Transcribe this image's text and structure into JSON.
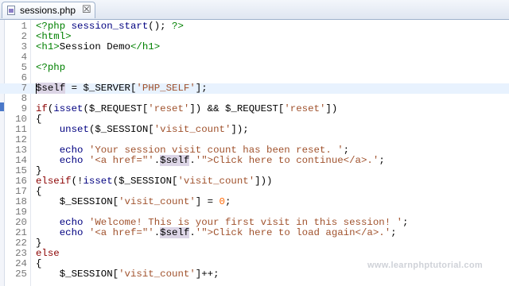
{
  "tab": {
    "filename": "sessions.php",
    "close_glyph": "☒"
  },
  "watermark": "www.learnphptutorial.com",
  "colors": {
    "tag": "#008000",
    "keyword": "#8b0000",
    "function": "#000080",
    "string": "#a0522d",
    "number": "#ff6600",
    "current_line": "#e8f2fe"
  },
  "current_line": 7,
  "lines": [
    {
      "n": "1",
      "tokens": [
        [
          "tag",
          "<?php "
        ],
        [
          "fn",
          "session_start"
        ],
        [
          "var",
          "(); "
        ],
        [
          "tag",
          "?>"
        ]
      ]
    },
    {
      "n": "2",
      "tokens": [
        [
          "tag",
          "<html>"
        ]
      ]
    },
    {
      "n": "3",
      "tokens": [
        [
          "tag",
          "<h1>"
        ],
        [
          "var",
          "Session Demo"
        ],
        [
          "tag",
          "</h1>"
        ]
      ]
    },
    {
      "n": "4",
      "tokens": []
    },
    {
      "n": "5",
      "tokens": [
        [
          "tag",
          "<?php"
        ]
      ]
    },
    {
      "n": "6",
      "tokens": []
    },
    {
      "n": "7",
      "tokens": [
        [
          "hl",
          "$self"
        ],
        [
          "var",
          " = $_SERVER["
        ],
        [
          "str",
          "'PHP_SELF'"
        ],
        [
          "var",
          "];"
        ]
      ]
    },
    {
      "n": "8",
      "tokens": []
    },
    {
      "n": "9",
      "tokens": [
        [
          "kw",
          "if"
        ],
        [
          "var",
          "("
        ],
        [
          "fn",
          "isset"
        ],
        [
          "var",
          "($_REQUEST["
        ],
        [
          "str",
          "'reset'"
        ],
        [
          "var",
          "]) && $_REQUEST["
        ],
        [
          "str",
          "'reset'"
        ],
        [
          "var",
          "])"
        ]
      ]
    },
    {
      "n": "10",
      "tokens": [
        [
          "var",
          "{"
        ]
      ]
    },
    {
      "n": "11",
      "tokens": [
        [
          "var",
          "    "
        ],
        [
          "fn",
          "unset"
        ],
        [
          "var",
          "($_SESSION["
        ],
        [
          "str",
          "'visit_count'"
        ],
        [
          "var",
          "]);"
        ]
      ]
    },
    {
      "n": "12",
      "tokens": []
    },
    {
      "n": "13",
      "tokens": [
        [
          "var",
          "    "
        ],
        [
          "fn",
          "echo"
        ],
        [
          "var",
          " "
        ],
        [
          "str",
          "'Your session visit count has been reset. '"
        ],
        [
          "var",
          ";"
        ]
      ]
    },
    {
      "n": "14",
      "tokens": [
        [
          "var",
          "    "
        ],
        [
          "fn",
          "echo"
        ],
        [
          "var",
          " "
        ],
        [
          "str",
          "'<a href=\"'"
        ],
        [
          "var",
          "."
        ],
        [
          "hl",
          "$self"
        ],
        [
          "var",
          "."
        ],
        [
          "str",
          "'\">Click here to continue</a>.'"
        ],
        [
          "var",
          ";"
        ]
      ]
    },
    {
      "n": "15",
      "tokens": [
        [
          "var",
          "}"
        ]
      ]
    },
    {
      "n": "16",
      "tokens": [
        [
          "kw",
          "elseif"
        ],
        [
          "var",
          "(!"
        ],
        [
          "fn",
          "isset"
        ],
        [
          "var",
          "($_SESSION["
        ],
        [
          "str",
          "'visit_count'"
        ],
        [
          "var",
          "]))"
        ]
      ]
    },
    {
      "n": "17",
      "tokens": [
        [
          "var",
          "{"
        ]
      ]
    },
    {
      "n": "18",
      "tokens": [
        [
          "var",
          "    $_SESSION["
        ],
        [
          "str",
          "'visit_count'"
        ],
        [
          "var",
          "] = "
        ],
        [
          "num",
          "0"
        ],
        [
          "var",
          ";"
        ]
      ]
    },
    {
      "n": "19",
      "tokens": []
    },
    {
      "n": "20",
      "tokens": [
        [
          "var",
          "    "
        ],
        [
          "fn",
          "echo"
        ],
        [
          "var",
          " "
        ],
        [
          "str",
          "'Welcome! This is your first visit in this session! '"
        ],
        [
          "var",
          ";"
        ]
      ]
    },
    {
      "n": "21",
      "tokens": [
        [
          "var",
          "    "
        ],
        [
          "fn",
          "echo"
        ],
        [
          "var",
          " "
        ],
        [
          "str",
          "'<a href=\"'"
        ],
        [
          "var",
          "."
        ],
        [
          "hl",
          "$self"
        ],
        [
          "var",
          "."
        ],
        [
          "str",
          "'\">Click here to load again</a>.'"
        ],
        [
          "var",
          ";"
        ]
      ]
    },
    {
      "n": "22",
      "tokens": [
        [
          "var",
          "}"
        ]
      ]
    },
    {
      "n": "23",
      "tokens": [
        [
          "kw",
          "else"
        ]
      ]
    },
    {
      "n": "24",
      "tokens": [
        [
          "var",
          "{"
        ]
      ]
    },
    {
      "n": "25",
      "tokens": [
        [
          "var",
          "    $_SESSION["
        ],
        [
          "str",
          "'visit_count'"
        ],
        [
          "var",
          "]++;"
        ]
      ]
    }
  ]
}
